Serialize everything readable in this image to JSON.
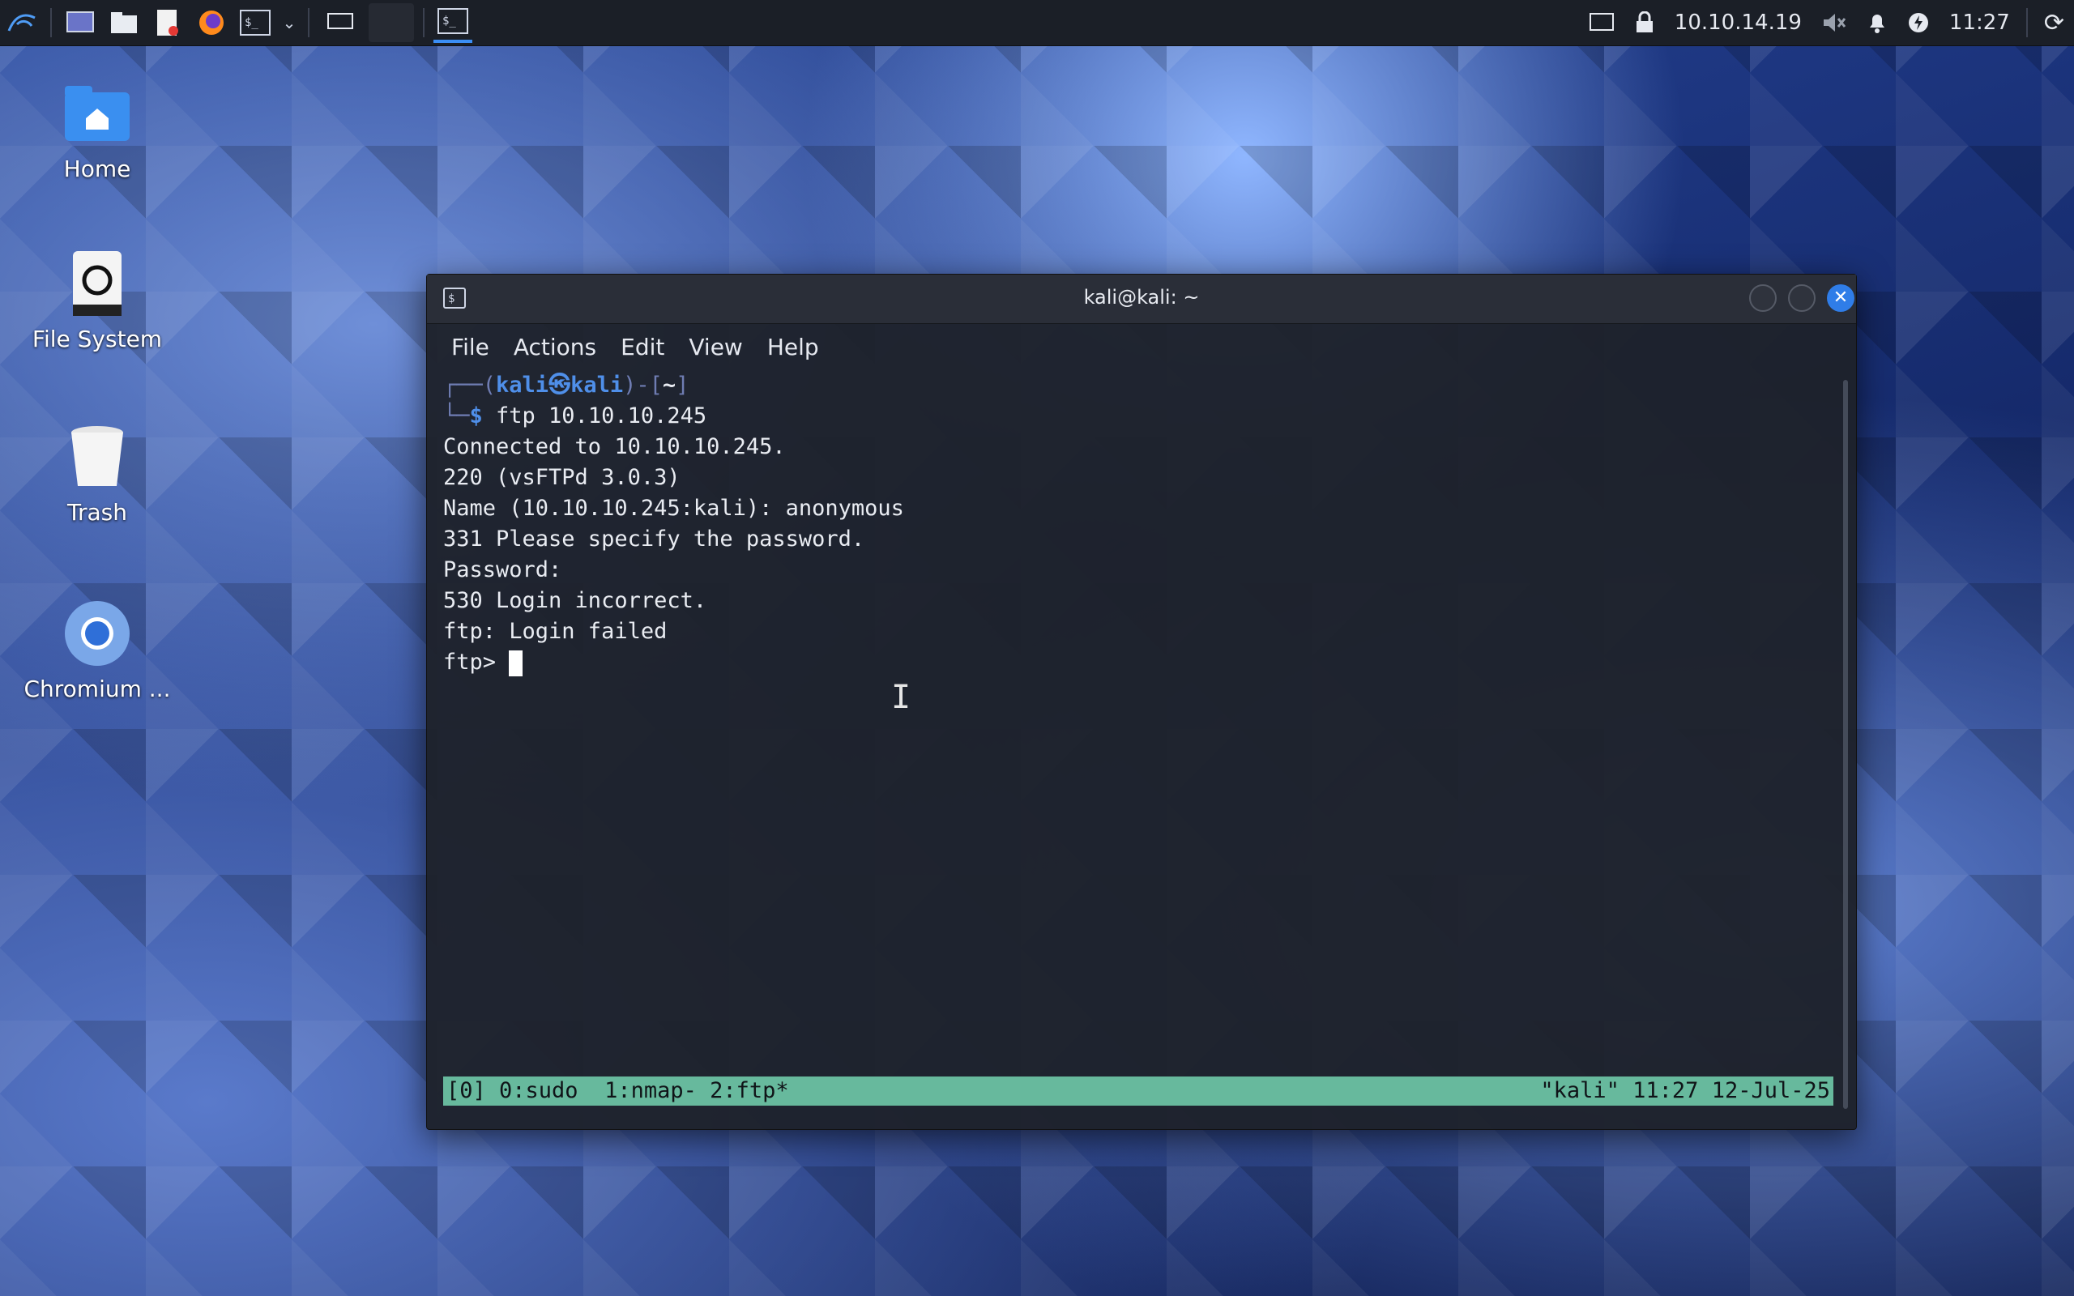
{
  "taskbar": {
    "ip": "10.10.14.19",
    "clock": "11:27"
  },
  "desktop": {
    "icons": [
      {
        "label": "Home"
      },
      {
        "label": "File System"
      },
      {
        "label": "Trash"
      },
      {
        "label": "Chromium ..."
      }
    ]
  },
  "window": {
    "title": "kali@kali: ~",
    "menu": [
      "File",
      "Actions",
      "Edit",
      "View",
      "Help"
    ]
  },
  "terminal": {
    "prompt_user": "kali",
    "prompt_host": "kali",
    "prompt_dir": "~",
    "command": "ftp 10.10.10.245",
    "lines": [
      "Connected to 10.10.10.245.",
      "220 (vsFTPd 3.0.3)",
      "Name (10.10.10.245:kali): anonymous",
      "331 Please specify the password.",
      "Password:",
      "530 Login incorrect.",
      "ftp: Login failed"
    ],
    "ftp_prompt": "ftp> "
  },
  "tmux": {
    "left": "[0] 0:sudo  1:nmap- 2:ftp*",
    "right": "\"kali\" 11:27 12-Jul-25"
  },
  "colors": {
    "accent": "#2f7de8",
    "status_bar": "#67b99d"
  }
}
